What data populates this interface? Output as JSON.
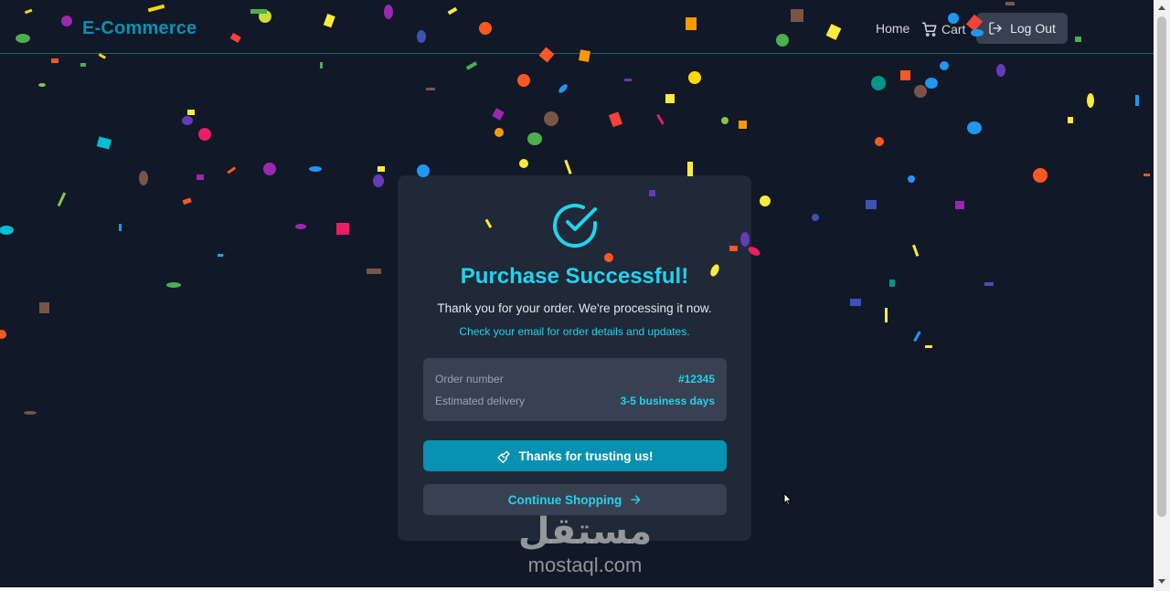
{
  "nav": {
    "brand": "E-Commerce",
    "home": "Home",
    "cart": "Cart",
    "logout": "Log Out"
  },
  "success": {
    "title": "Purchase Successful!",
    "subtitle": "Thank you for your order. We're processing it now.",
    "email_note": "Check your email for order details and updates.",
    "order_label": "Order number",
    "order_value": "#12345",
    "delivery_label": "Estimated delivery",
    "delivery_value": "3-5 business days",
    "thanks_button": "Thanks for trusting us!",
    "continue_button": "Continue Shopping"
  },
  "watermark": {
    "arabic": "مستقل",
    "latin": "mostaql.com"
  },
  "colors": {
    "background": "#111827",
    "card": "#1f2937",
    "accent": "#22d3ee",
    "primary_button": "#0891b2",
    "secondary_button": "#374151"
  },
  "icons": [
    "check-circle-icon",
    "cart-icon",
    "logout-icon",
    "handshake-icon",
    "arrow-right-icon"
  ]
}
